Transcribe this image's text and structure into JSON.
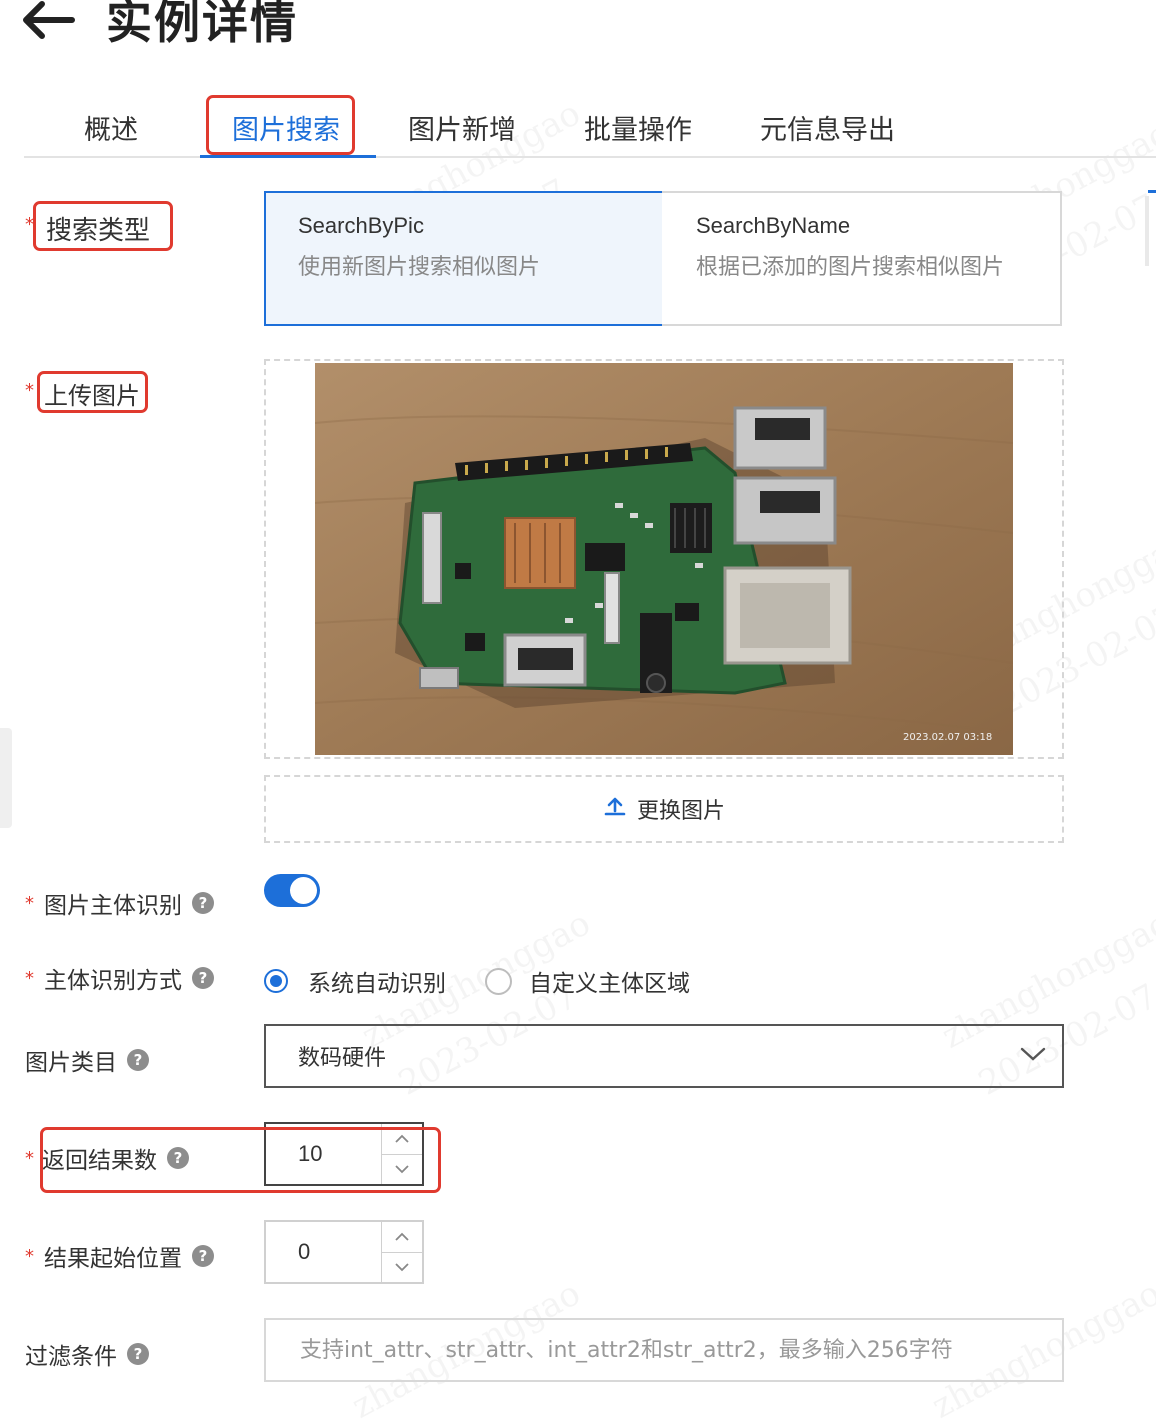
{
  "header": {
    "title": "实例详情",
    "back_icon": "arrow-left-icon"
  },
  "tabs": [
    {
      "label": "概述",
      "active": false
    },
    {
      "label": "图片搜索",
      "active": true
    },
    {
      "label": "图片新增",
      "active": false
    },
    {
      "label": "批量操作",
      "active": false
    },
    {
      "label": "元信息导出",
      "active": false
    }
  ],
  "form": {
    "search_type": {
      "label": "搜索类型",
      "required": true,
      "options": [
        {
          "name": "SearchByPic",
          "desc": "使用新图片搜索相似图片",
          "selected": true
        },
        {
          "name": "SearchByName",
          "desc": "根据已添加的图片搜索相似图片",
          "selected": false
        }
      ]
    },
    "upload": {
      "label": "上传图片",
      "required": true,
      "photo_timestamp": "2023.02.07  03:18",
      "replace_label": "更换图片",
      "replace_icon": "upload-icon"
    },
    "subject_detect": {
      "label": "图片主体识别",
      "required": true,
      "enabled": true
    },
    "detect_mode": {
      "label": "主体识别方式",
      "required": true,
      "options": [
        {
          "label": "系统自动识别",
          "selected": true
        },
        {
          "label": "自定义主体区域",
          "selected": false
        }
      ]
    },
    "category": {
      "label": "图片类目",
      "required": false,
      "value": "数码硬件"
    },
    "result_count": {
      "label": "返回结果数",
      "required": true,
      "value": "10"
    },
    "result_start": {
      "label": "结果起始位置",
      "required": true,
      "value": "0"
    },
    "filter": {
      "label": "过滤条件",
      "required": false,
      "placeholder": "支持int_attr、str_attr、int_attr2和str_attr2，最多输入256字符"
    }
  },
  "help_icon_char": "?",
  "required_mark": "*",
  "colors": {
    "accent": "#1d6fd9",
    "highlight": "#e03a2f",
    "required": "#e03a2f"
  },
  "watermark": {
    "name": "zhanghonggao",
    "date": "2023-02-07"
  }
}
